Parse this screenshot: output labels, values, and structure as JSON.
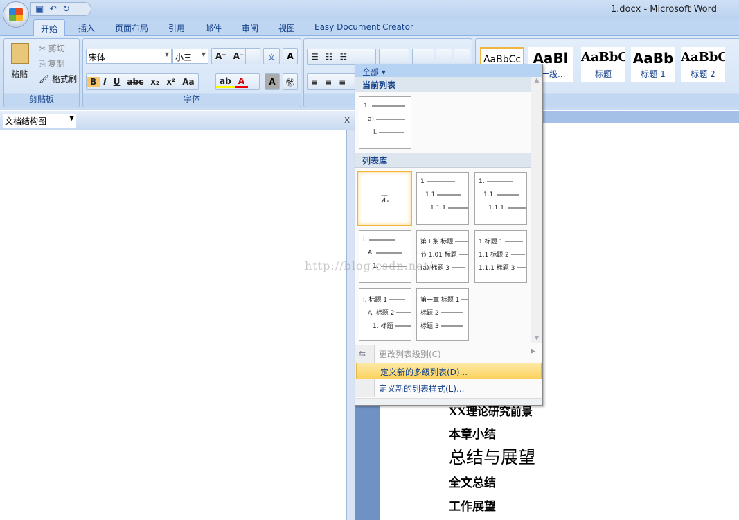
{
  "window": {
    "title": "1.docx - Microsoft Word"
  },
  "tabs": [
    "开始",
    "插入",
    "页面布局",
    "引用",
    "邮件",
    "审阅",
    "视图",
    "Easy Document Creator"
  ],
  "clipboard": {
    "paste": "粘贴",
    "cut": "剪切",
    "copy": "复制",
    "format_painter": "格式刷",
    "label": "剪贴板"
  },
  "font": {
    "name": "宋体",
    "size": "小三",
    "label": "字体",
    "buttons": [
      "B",
      "I",
      "U",
      "abc",
      "x₂",
      "x²",
      "Aa"
    ]
  },
  "styles": [
    {
      "preview": "AaBbCc",
      "name": ""
    },
    {
      "preview": "AaBl",
      "name": "Y一级..."
    },
    {
      "preview": "AaBbC",
      "name": "标题"
    },
    {
      "preview": "AaBb",
      "name": "标题 1"
    },
    {
      "preview": "AaBbC",
      "name": "标题 2"
    }
  ],
  "docmap": {
    "selected": "文档结构图",
    "close": "x"
  },
  "menu": {
    "filter": "全部 ▾",
    "current_section": "当前列表",
    "library_section": "列表库",
    "current_list": [
      "1.",
      "a)",
      "i."
    ],
    "none": "无",
    "tiles": [
      [
        "1",
        "1.1",
        "1.1.1"
      ],
      [
        "1.",
        "1.1.",
        "1.1.1."
      ],
      [
        "I.",
        "A.",
        "1."
      ],
      [
        "第 Ⅰ 条 标题",
        "节 1.01 标题",
        "(a) 标题 3"
      ],
      [
        "1 标题 1",
        "1.1 标题 2",
        "1.1.1 标题 3"
      ],
      [
        "I. 标题 1",
        "A. 标题 2",
        "1. 标题"
      ],
      [
        "第一章 标题 1",
        "标题 2",
        "标题 3"
      ]
    ],
    "items": [
      {
        "label": "更改列表级别(C)",
        "disabled": true
      },
      {
        "label": "定义新的多级列表(D)...",
        "highlighted": true
      },
      {
        "label": "定义新的列表样式(L)..."
      }
    ]
  },
  "document": {
    "lines": [
      "XX理论研究前景",
      "本章小结",
      "总结与展望",
      "全文总结",
      "工作展望"
    ]
  },
  "watermark": "http://blog.csdn.net/"
}
